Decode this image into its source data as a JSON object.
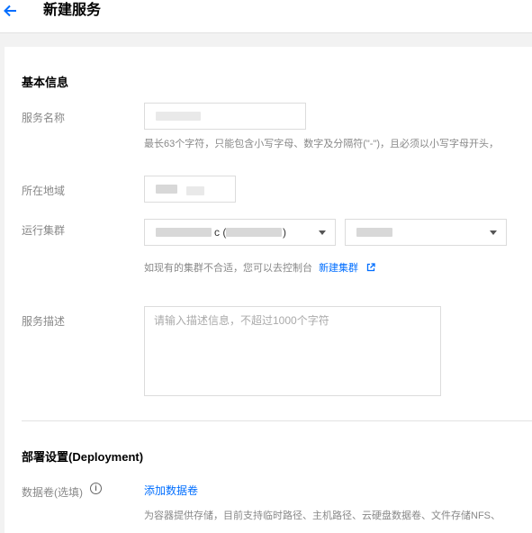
{
  "header": {
    "back_icon": "arrow-left-icon",
    "title": "新建服务"
  },
  "basic": {
    "section_title": "基本信息",
    "service_name": {
      "label": "服务名称",
      "help": "最长63个字符，只能包含小写字母、数字及分隔符(\"-\")，且必须以小写字母开头，"
    },
    "region": {
      "label": "所在地域"
    },
    "cluster": {
      "label": "运行集群",
      "select1_suffix": "c (",
      "select1_close": ")",
      "help_text": "如现有的集群不合适，您可以去控制台",
      "help_link": "新建集群",
      "external_icon": "external-link-icon"
    },
    "description": {
      "label": "服务描述",
      "placeholder": "请输入描述信息，不超过1000个字符"
    }
  },
  "deployment": {
    "section_title": "部署设置(Deployment)",
    "volume": {
      "label": "数据卷(选填)",
      "info_icon": "info-icon",
      "add_link": "添加数据卷",
      "help": "为容器提供存储，目前支持临时路径、主机路径、云硬盘数据卷、文件存储NFS、"
    }
  },
  "colors": {
    "accent": "#006eff",
    "label": "#888888",
    "border": "#dcdcdc"
  }
}
